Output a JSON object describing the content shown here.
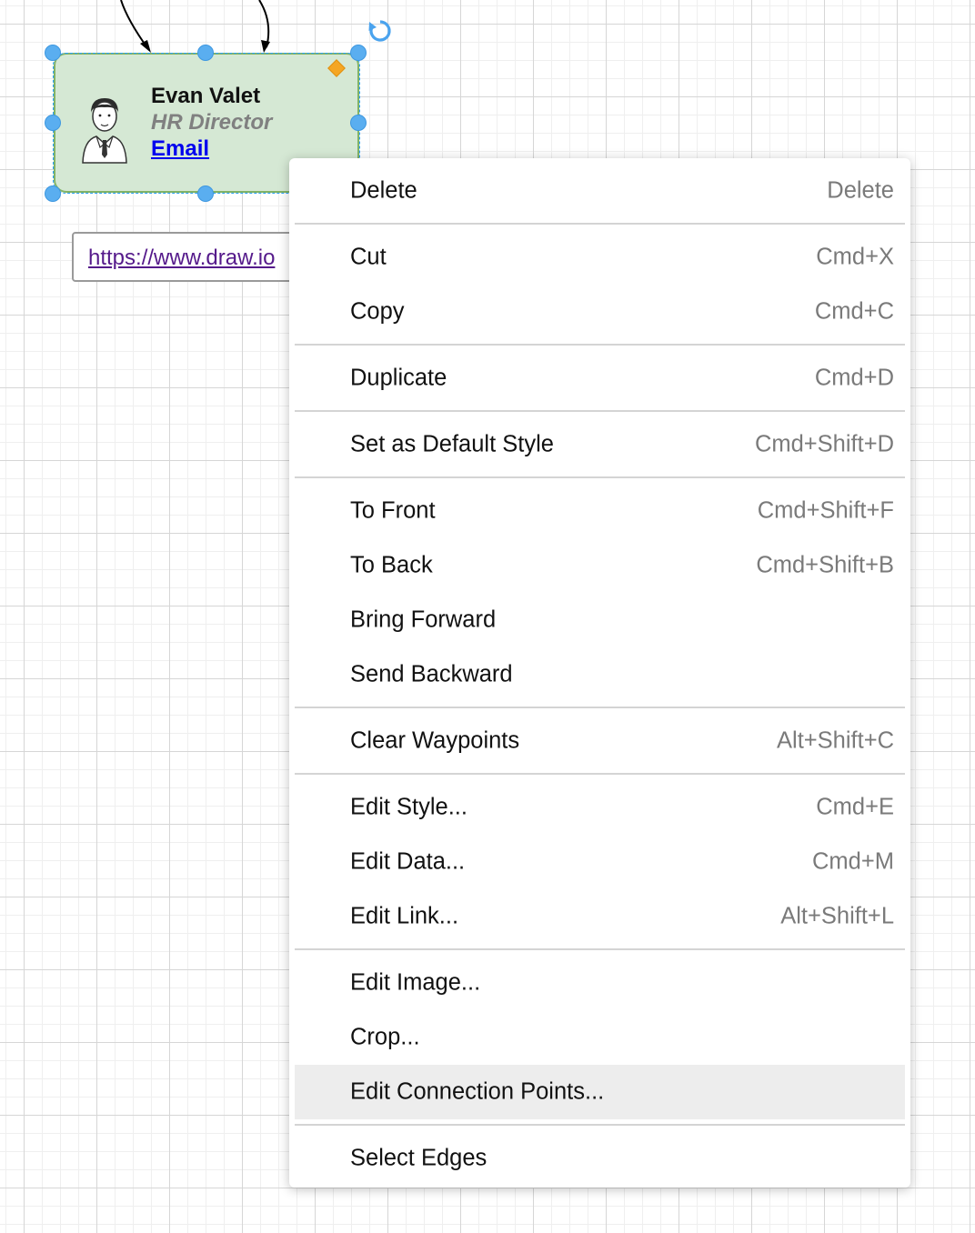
{
  "card": {
    "name": "Evan Valet",
    "title": "HR Director",
    "link_label": "Email",
    "fill_color": "#d5e8d4",
    "border_color": "#82b366"
  },
  "link_tooltip": {
    "url": "https://www.draw.io"
  },
  "context_menu": {
    "groups": [
      [
        {
          "label": "Delete",
          "shortcut": "Delete"
        }
      ],
      [
        {
          "label": "Cut",
          "shortcut": "Cmd+X"
        },
        {
          "label": "Copy",
          "shortcut": "Cmd+C"
        }
      ],
      [
        {
          "label": "Duplicate",
          "shortcut": "Cmd+D"
        }
      ],
      [
        {
          "label": "Set as Default Style",
          "shortcut": "Cmd+Shift+D"
        }
      ],
      [
        {
          "label": "To Front",
          "shortcut": "Cmd+Shift+F"
        },
        {
          "label": "To Back",
          "shortcut": "Cmd+Shift+B"
        },
        {
          "label": "Bring Forward",
          "shortcut": ""
        },
        {
          "label": "Send Backward",
          "shortcut": ""
        }
      ],
      [
        {
          "label": "Clear Waypoints",
          "shortcut": "Alt+Shift+C"
        }
      ],
      [
        {
          "label": "Edit Style...",
          "shortcut": "Cmd+E"
        },
        {
          "label": "Edit Data...",
          "shortcut": "Cmd+M"
        },
        {
          "label": "Edit Link...",
          "shortcut": "Alt+Shift+L"
        }
      ],
      [
        {
          "label": "Edit Image...",
          "shortcut": ""
        },
        {
          "label": "Crop...",
          "shortcut": ""
        },
        {
          "label": "Edit Connection Points...",
          "shortcut": "",
          "highlighted": true
        }
      ],
      [
        {
          "label": "Select Edges",
          "shortcut": ""
        }
      ]
    ]
  },
  "colors": {
    "selection_handle": "#5aaef0",
    "highlight": "#ededed",
    "shortcut_text": "#7a7a7a",
    "link_text": "#0000ee"
  }
}
